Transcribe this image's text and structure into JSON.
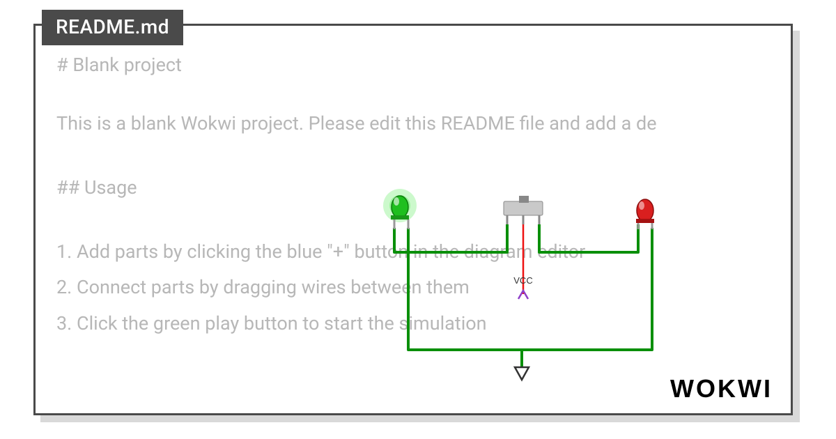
{
  "tab": {
    "title": "README.md"
  },
  "readme": {
    "heading": "# Blank project",
    "description": "This is a blank Wokwi project. Please edit this README file and add a de",
    "usage_heading": "## Usage",
    "steps": [
      "1. Add parts by clicking the blue \"+\" button in the diagram editor",
      "2. Connect parts by dragging wires between them",
      "3. Click the green play button to start the simulation"
    ]
  },
  "diagram": {
    "vcc_label": "VCC",
    "components": {
      "led_green": "green-led",
      "led_red": "red-led",
      "switch": "slide-switch",
      "vcc": "vcc-source",
      "gnd": "ground"
    }
  },
  "brand": {
    "name": "WOKWI"
  }
}
